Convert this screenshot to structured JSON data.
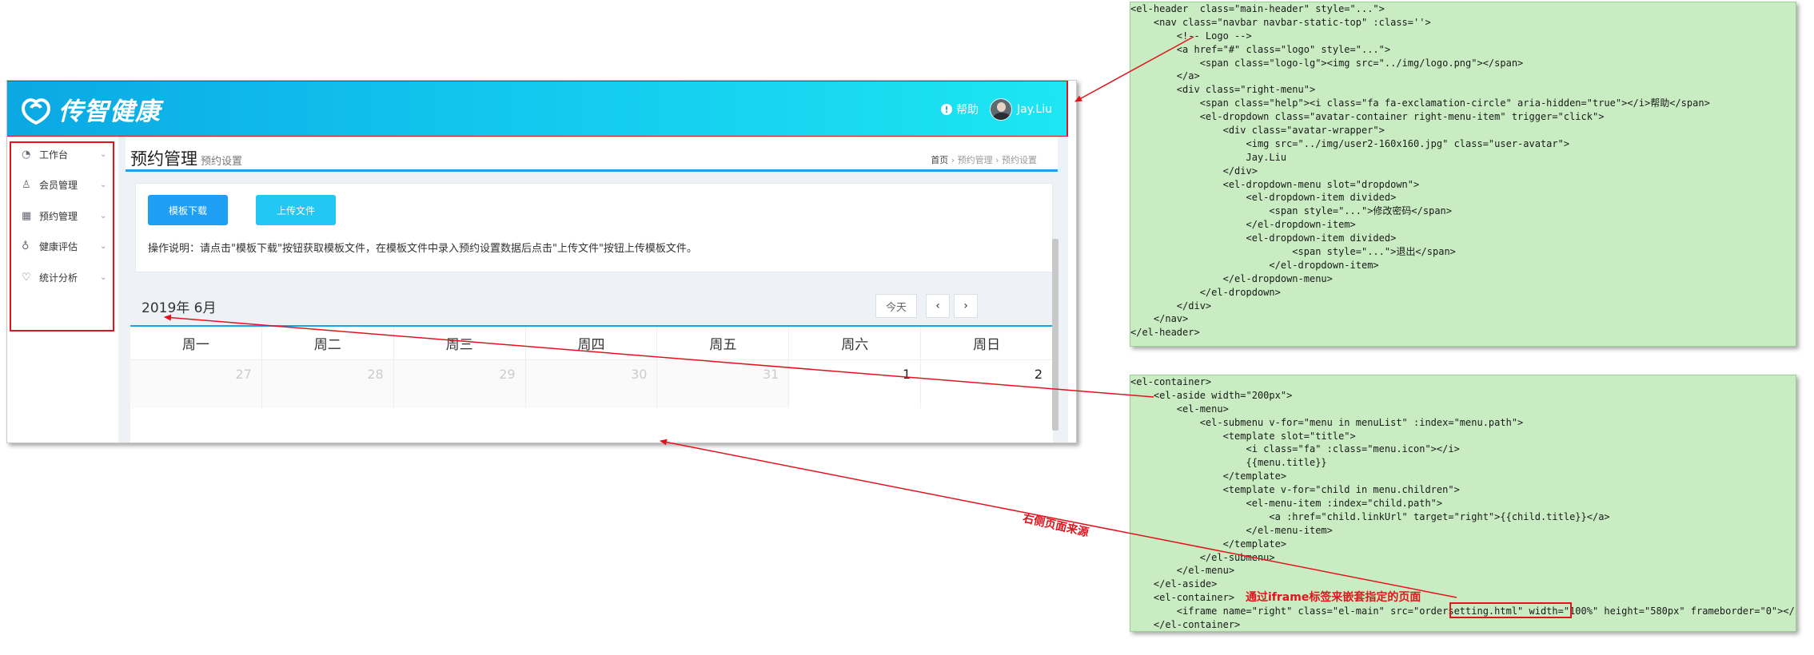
{
  "app": {
    "logo_text": "传智健康",
    "help_label": "帮助",
    "user_name": "Jay.Liu"
  },
  "sidebar": {
    "items": [
      {
        "icon": "dashboard-icon",
        "label": "工作台"
      },
      {
        "icon": "user-icon",
        "label": "会员管理"
      },
      {
        "icon": "calendar-icon",
        "label": "预约管理"
      },
      {
        "icon": "stethoscope-icon",
        "label": "健康评估"
      },
      {
        "icon": "heartbeat-icon",
        "label": "统计分析"
      }
    ]
  },
  "main": {
    "title": "预约管理",
    "subtitle": "预约设置",
    "breadcrumb": [
      "首页",
      "预约管理",
      "预约设置"
    ],
    "buttons": {
      "download": "模板下载",
      "upload": "上传文件"
    },
    "instruction": "操作说明：请点击\"模板下载\"按钮获取模板文件，在模板文件中录入预约设置数据后点击\"上传文件\"按钮上传模板文件。",
    "month_title": "2019年 6月",
    "today_label": "今天",
    "prev_label": "‹",
    "next_label": "›",
    "weekdays": [
      "周一",
      "周二",
      "周三",
      "周四",
      "周五",
      "周六",
      "周日"
    ],
    "first_week": [
      {
        "day": "27",
        "other": true
      },
      {
        "day": "28",
        "other": true
      },
      {
        "day": "29",
        "other": true
      },
      {
        "day": "30",
        "other": true
      },
      {
        "day": "31",
        "other": true
      },
      {
        "day": "1",
        "other": false
      },
      {
        "day": "2",
        "other": false
      }
    ]
  },
  "code_top": [
    "<el-header  class=\"main-header\" style=\"...\">",
    "    <nav class=\"navbar navbar-static-top\" :class=''>",
    "        <!-- Logo -->",
    "        <a href=\"#\" class=\"logo\" style=\"...\">",
    "            <span class=\"logo-lg\"><img src=\"../img/logo.png\"></span>",
    "        </a>",
    "        <div class=\"right-menu\">",
    "            <span class=\"help\"><i class=\"fa fa-exclamation-circle\" aria-hidden=\"true\"></i>帮助</span>",
    "            <el-dropdown class=\"avatar-container right-menu-item\" trigger=\"click\">",
    "                <div class=\"avatar-wrapper\">",
    "                    <img src=\"../img/user2-160x160.jpg\" class=\"user-avatar\">",
    "                    Jay.Liu",
    "                </div>",
    "                <el-dropdown-menu slot=\"dropdown\">",
    "                    <el-dropdown-item divided>",
    "                        <span style=\"...\">修改密码</span>",
    "                    </el-dropdown-item>",
    "                    <el-dropdown-item divided>",
    "                            <span style=\"...\">退出</span>",
    "                        </el-dropdown-item>",
    "                </el-dropdown-menu>",
    "            </el-dropdown>",
    "        </div>",
    "    </nav>",
    "</el-header>"
  ],
  "code_bottom": [
    "<el-container>",
    "    <el-aside width=\"200px\">",
    "        <el-menu>",
    "            <el-submenu v-for=\"menu in menuList\" :index=\"menu.path\">",
    "                <template slot=\"title\">",
    "                    <i class=\"fa\" :class=\"menu.icon\"></i>",
    "                    {{menu.title}}",
    "                </template>",
    "                <template v-for=\"child in menu.children\">",
    "                    <el-menu-item :index=\"child.path\">",
    "                        <a :href=\"child.linkUrl\" target=\"right\">{{child.title}}</a>",
    "                    </el-menu-item>",
    "                </template>",
    "            </el-submenu>",
    "        </el-menu>",
    "    </el-aside>",
    "    <el-container>",
    "        <iframe name=\"right\" class=\"el-main\" src=\"ordersetting.html\" width=\"100%\" height=\"580px\" frameborder=\"0\"></iframe>",
    "    </el-container>"
  ],
  "annotations": {
    "right_source": "右侧页面来源",
    "iframe_note": "通过iframe标签来嵌套指定的页面"
  },
  "colors": {
    "accent": "#1ca3ea",
    "annotation": "#e3131d",
    "code_bg": "#c9ecc3"
  }
}
